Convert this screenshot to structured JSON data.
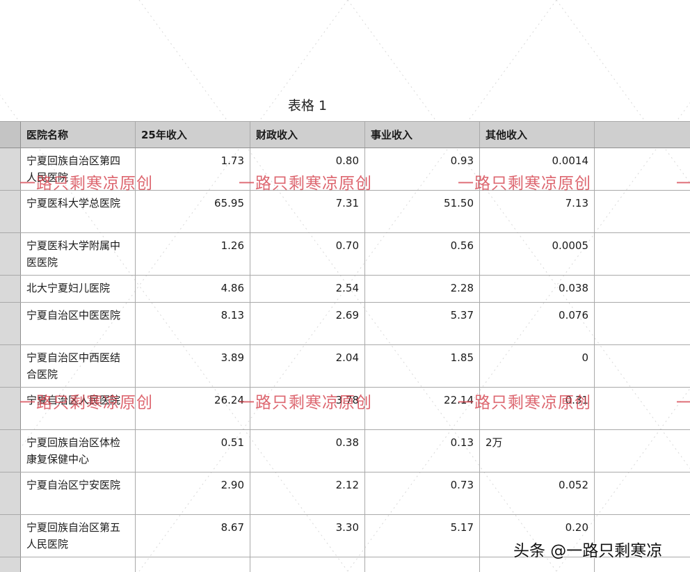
{
  "table_title": "表格 1",
  "headers": [
    "医院名称",
    "25年收入",
    "财政收入",
    "事业收入",
    "其他收入"
  ],
  "rows": [
    {
      "name": "宁夏回族自治区第四人民医院",
      "income_25": "1.73",
      "fiscal": "0.80",
      "business": "0.93",
      "other": "0.0014"
    },
    {
      "name": "宁夏医科大学总医院",
      "income_25": "65.95",
      "fiscal": "7.31",
      "business": "51.50",
      "other": "7.13"
    },
    {
      "name": "宁夏医科大学附属中医医院",
      "income_25": "1.26",
      "fiscal": "0.70",
      "business": "0.56",
      "other": "0.0005"
    },
    {
      "name": "北大宁夏妇儿医院",
      "income_25": "4.86",
      "fiscal": "2.54",
      "business": "2.28",
      "other": "0.038"
    },
    {
      "name": "宁夏自治区中医医院",
      "income_25": "8.13",
      "fiscal": "2.69",
      "business": "5.37",
      "other": "0.076"
    },
    {
      "name": "宁夏自治区中西医结合医院",
      "income_25": "3.89",
      "fiscal": "2.04",
      "business": "1.85",
      "other": "0"
    },
    {
      "name": "宁夏自治区人民医院",
      "income_25": "26.24",
      "fiscal": "3.78",
      "business": "22.14",
      "other": "0.31"
    },
    {
      "name": "宁夏回族自治区体检康复保健中心",
      "income_25": "0.51",
      "fiscal": "0.38",
      "business": "0.13",
      "other": "2万"
    },
    {
      "name": "宁夏自治区宁安医院",
      "income_25": "2.90",
      "fiscal": "2.12",
      "business": "0.73",
      "other": "0.052"
    },
    {
      "name": "宁夏回族自治区第五人民医院",
      "income_25": "8.67",
      "fiscal": "3.30",
      "business": "5.17",
      "other": "0.20"
    }
  ],
  "watermark_text": "一路只剩寒凉原创",
  "watermark_edge": "一",
  "credit": "头条 @一路只剩寒凉",
  "colors": {
    "header_bg": "#cfcfcf",
    "row_header_bg": "#d9d9d9",
    "grid_line": "#a9a9a9",
    "watermark": "#d64650"
  }
}
